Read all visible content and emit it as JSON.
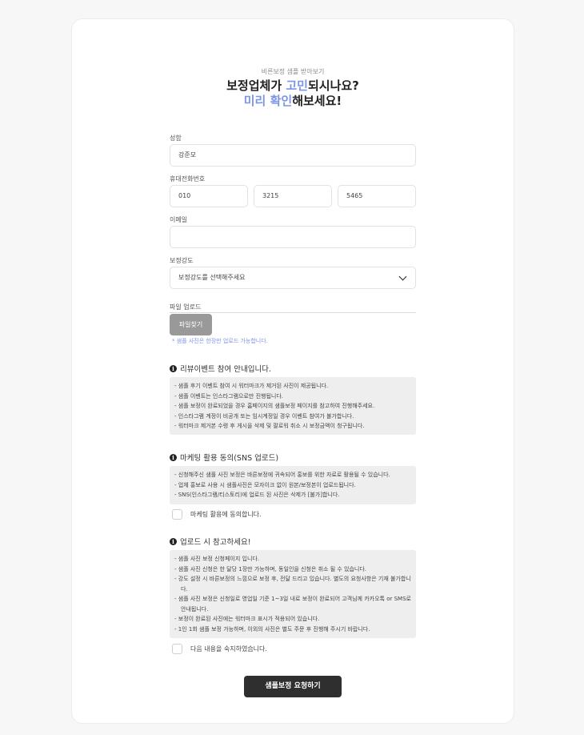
{
  "header": {
    "subtitle": "비른보정 샘플 받아보기",
    "title_line1_pre": "보정업체가 ",
    "title_line1_hl": "고민",
    "title_line1_post": "되시나요?",
    "title_line2_hl": "미리 확인",
    "title_line2_post": "해보세요!"
  },
  "form": {
    "name_label": "성함",
    "name_value": "강준모",
    "phone_label": "휴대전화번호",
    "phone1": "010",
    "phone2": "3215",
    "phone3": "5465",
    "email_label": "이메일",
    "email_value": "",
    "strength_label": "보정강도",
    "strength_value": "보정강도를 선택해주세요",
    "upload_label": "파일 업로드",
    "upload_button": "파일찾기",
    "upload_hint": "* 샘플 사진은 한장만 업로드 가능합니다."
  },
  "review_section": {
    "title": "리뷰이벤트 참여 안내입니다.",
    "items": [
      "샘플 후기 이벤트 참여 시 워터마크가 제거된 사진이 제공됩니다.",
      "샘플 이벤트는 인스타그램으로만 진행됩니다.",
      "샘플 보정이 완료되었을 경우 홈페이지의 샘플보정 페이지를 참고하여 진행해주세요.",
      "인스타그램 계정이 비공개 또는 임시계정일 경우 이벤트 참여가 불가합니다.",
      "워터마크 제거본 수령 후 게시을 삭제 및 팔로워 취소 시 보정금액이 청구됩니다."
    ]
  },
  "marketing_section": {
    "title": "마케팅 활용 동의(SNS 업로드)",
    "items": [
      "신청해주신 샘플 사진 보정은 바른보정에 귀속되어 홍보를 위한 자료로 활용될 수 있습니다.",
      "업체 홍보로 사용 시 샘플사진은 모자이크 없이 원본/보정본이 업로드됩니다.",
      "SNS(인스타그램/티스토리)에 업로드 된 사진은 삭제가 [불가]합니다."
    ],
    "checkbox_label": "마케팅 활용에 동의합니다."
  },
  "notice_section": {
    "title": "업로드 시 참고하세요!",
    "items": [
      "샘플 사진 보정 신청페이지 입니다.",
      "샘플 사진 신청은 한 달당 1장만 가능하며, 동일인을 신청은 취소 될 수 있습니다.",
      "강도 설정 시 바른보정의 느낌으로 보정 후, 전달 드리고 있습니다. 별도의 요청사항은 기재 불가합니다.",
      "샘플 사진 보정은 신청일로 영업일 기준 1~3일 내로 보정이 완료되어 고객님께 카카오톡 or SMS로 안내됩니다.",
      "보정이 완료된 사진에는 워터마크 표시가 적용되어 있습니다.",
      "1인 1회 샘플 보정 가능하며, 이외의 사진은 별도 주문 후 진행해 주시기 바랍니다."
    ],
    "checkbox_label": "다음 내용을 숙지하였습니다."
  },
  "submit_label": "샘플보정 요청하기",
  "colors": {
    "accent": "#7d95e6",
    "submit_bg": "#2f2f2f",
    "upload_bg": "#999999"
  },
  "icons": {
    "section_info": "info-icon",
    "select_toggle": "chevron-down-icon"
  }
}
